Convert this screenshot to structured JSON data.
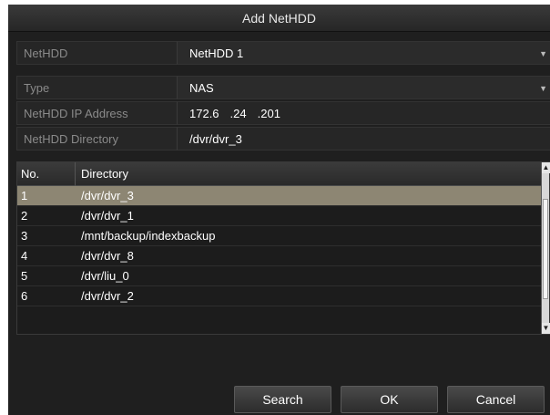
{
  "dialog": {
    "title": "Add NetHDD"
  },
  "form": {
    "nethdd": {
      "label": "NetHDD",
      "value": "NetHDD 1"
    },
    "type": {
      "label": "Type",
      "value": "NAS"
    },
    "ip": {
      "label": "NetHDD IP Address",
      "segments": [
        "172.6",
        ".24",
        ".201"
      ]
    },
    "directory": {
      "label": "NetHDD Directory",
      "value": "/dvr/dvr_3"
    }
  },
  "table": {
    "headers": {
      "no": "No.",
      "directory": "Directory"
    },
    "rows": [
      {
        "no": "1",
        "directory": "/dvr/dvr_3"
      },
      {
        "no": "2",
        "directory": "/dvr/dvr_1"
      },
      {
        "no": "3",
        "directory": "/mnt/backup/indexbackup"
      },
      {
        "no": "4",
        "directory": "/dvr/dvr_8"
      },
      {
        "no": "5",
        "directory": "/dvr/liu_0"
      },
      {
        "no": "6",
        "directory": "/dvr/dvr_2"
      }
    ],
    "selected_row": 1
  },
  "buttons": {
    "search": "Search",
    "ok": "OK",
    "cancel": "Cancel"
  },
  "icons": {
    "dropdown": "chevron-down-icon",
    "scroll_up": "chevron-up-icon",
    "scroll_down": "chevron-down-icon"
  },
  "colors": {
    "selected_row": "#8d8673",
    "background": "#1f1f1f"
  }
}
